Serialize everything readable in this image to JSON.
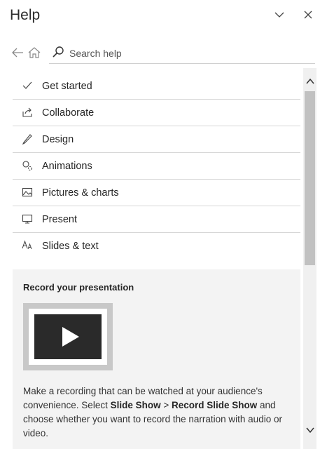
{
  "header": {
    "title": "Help",
    "collapse_icon": "chevron-down-icon",
    "close_icon": "close-icon"
  },
  "nav": {
    "back_icon": "back-arrow-icon",
    "home_icon": "home-icon"
  },
  "search": {
    "icon": "search-icon",
    "placeholder": "Search help",
    "value": ""
  },
  "menu": {
    "items": [
      {
        "label": "Get started",
        "icon": "checkmark-icon"
      },
      {
        "label": "Collaborate",
        "icon": "share-icon"
      },
      {
        "label": "Design",
        "icon": "pen-icon"
      },
      {
        "label": "Animations",
        "icon": "animation-icon"
      },
      {
        "label": "Pictures & charts",
        "icon": "picture-icon"
      },
      {
        "label": "Present",
        "icon": "monitor-icon"
      },
      {
        "label": "Slides & text",
        "icon": "text-size-icon"
      }
    ]
  },
  "card": {
    "title": "Record your presentation",
    "video_icon": "play-icon",
    "text_before": "Make a recording that can be watched at your audience's convenience. Select ",
    "bold_1": "Slide Show",
    "sep": " > ",
    "bold_2": "Record Slide Show",
    "text_after": " and choose whether you want to record the narration with audio or video."
  },
  "scrollbar": {
    "up_icon": "chevron-up-icon",
    "down_icon": "chevron-down-icon"
  }
}
